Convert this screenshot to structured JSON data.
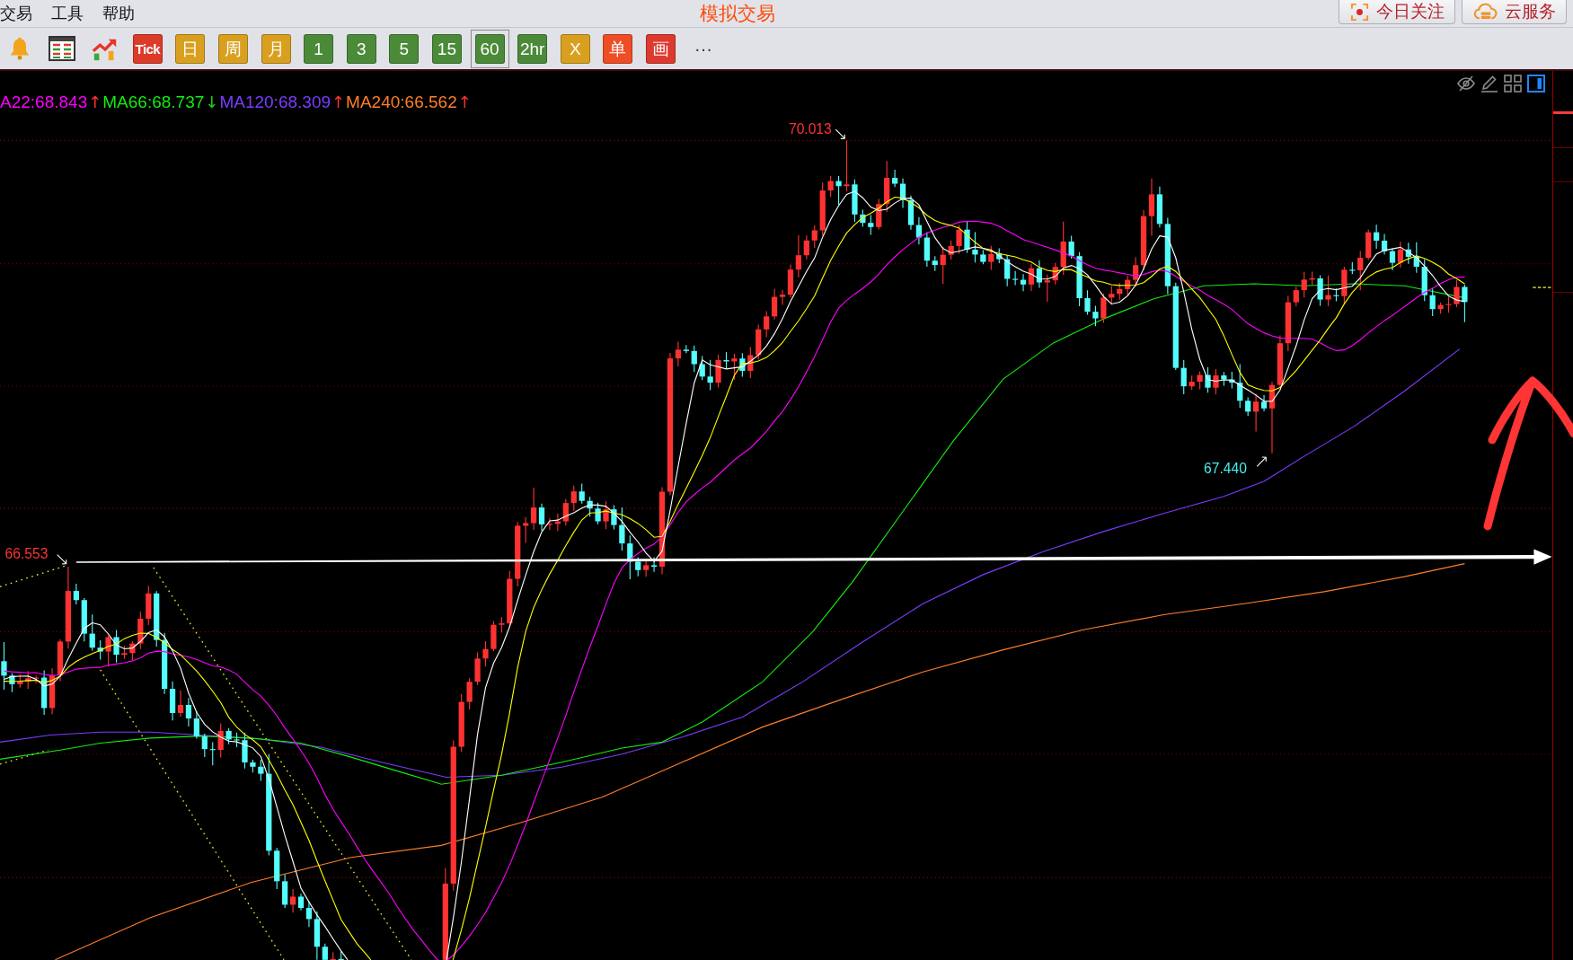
{
  "menu": [
    "交易",
    "工具",
    "帮助"
  ],
  "title": "模拟交易",
  "top_buttons": [
    {
      "label": "今日关注",
      "kind": "focus"
    },
    {
      "label": "云服务",
      "kind": "cloud"
    }
  ],
  "toolbar": [
    {
      "kind": "bell",
      "selected": false
    },
    {
      "kind": "table",
      "selected": false
    },
    {
      "kind": "chart",
      "selected": false
    },
    {
      "kind": "badge",
      "label": "Tick",
      "color": "#dc3b2a",
      "selected": false
    },
    {
      "kind": "text",
      "label": "日",
      "color": "#d9a020",
      "selected": false
    },
    {
      "kind": "text",
      "label": "周",
      "color": "#d9a020",
      "selected": false
    },
    {
      "kind": "text",
      "label": "月",
      "color": "#d9a020",
      "selected": false
    },
    {
      "kind": "text",
      "label": "1",
      "color": "#4b8a39",
      "selected": false
    },
    {
      "kind": "text",
      "label": "3",
      "color": "#4b8a39",
      "selected": false
    },
    {
      "kind": "text",
      "label": "5",
      "color": "#4b8a39",
      "selected": false
    },
    {
      "kind": "text",
      "label": "15",
      "color": "#4b8a39",
      "selected": false
    },
    {
      "kind": "text",
      "label": "60",
      "color": "#4b8a39",
      "selected": true
    },
    {
      "kind": "text",
      "label": "2hr",
      "color": "#4b8a39",
      "selected": false
    },
    {
      "kind": "text",
      "label": "X",
      "color": "#d9a020",
      "selected": false
    },
    {
      "kind": "text",
      "label": "单",
      "color": "#ee4d25",
      "selected": false
    },
    {
      "kind": "text",
      "label": "画",
      "color": "#dc3a2e",
      "selected": false
    },
    {
      "kind": "more",
      "label": "···",
      "selected": false
    }
  ],
  "chart": {
    "legend": [
      {
        "label": "A22:68.843",
        "color": "#ff00ff",
        "arrow": {
          "text": "↑",
          "color": "#ff3030"
        }
      },
      {
        "label": "MA66:68.737",
        "color": "#11ee11",
        "arrow": {
          "text": "↓",
          "color": "#19d319"
        }
      },
      {
        "label": "MA120:68.309",
        "color": "#7b3cff",
        "arrow": {
          "text": "↑",
          "color": "#ff3030"
        }
      },
      {
        "label": "MA240:66.562",
        "color": "#ff7f27",
        "arrow": {
          "text": "↑",
          "color": "#ff3030"
        }
      }
    ],
    "price_labels": [
      {
        "text": "70.013",
        "kind": "high"
      },
      {
        "text": "66.553",
        "kind": "high"
      },
      {
        "text": "67.440",
        "kind": "low"
      }
    ]
  }
}
